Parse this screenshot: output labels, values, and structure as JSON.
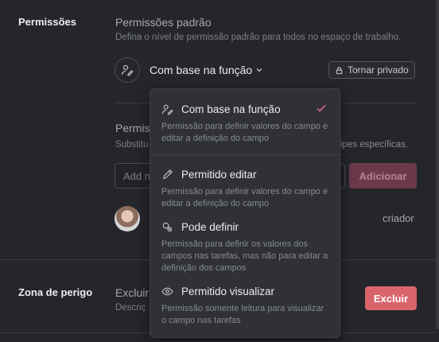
{
  "permissions": {
    "section_label": "Permissões",
    "title": "Permissões padrão",
    "description": "Defina o nível de permissão padrão para todos no espaço de trabalho.",
    "role_button_label": "Com base na função",
    "private_button_label": "Tornar privado",
    "specific_title_partial": "Permiss",
    "specific_desc_partial_left": "Substitu",
    "specific_desc_partial_right": "ipes específicas.",
    "input_placeholder_partial": "Add n",
    "add_button_label": "Adicionar",
    "member_role": "criador"
  },
  "danger_zone": {
    "section_label": "Zona de perigo",
    "title_partial": "Excluir",
    "desc_partial": "Descriç",
    "delete_button_label": "Excluir"
  },
  "dropdown": {
    "items": [
      {
        "icon": "role-based-icon",
        "label": "Com base na função",
        "description": "Permissão para definir valores do campo e editar a definição do campo",
        "selected": true
      },
      {
        "icon": "pencil-icon",
        "label": "Permitido editar",
        "description": "Permissão para definir valores do campo e editar a definição do campo",
        "selected": false
      },
      {
        "icon": "can-set-icon",
        "label": "Pode definir",
        "description": "Permissão para definir os valores dos campos nas tarefas, mas não para editar a definição dos campos",
        "selected": false
      },
      {
        "icon": "eye-icon",
        "label": "Permitido visualizar",
        "description": "Permissão somente leitura para visualizar o campo nas tarefas",
        "selected": false
      }
    ],
    "check_color": "#d26a8c"
  }
}
